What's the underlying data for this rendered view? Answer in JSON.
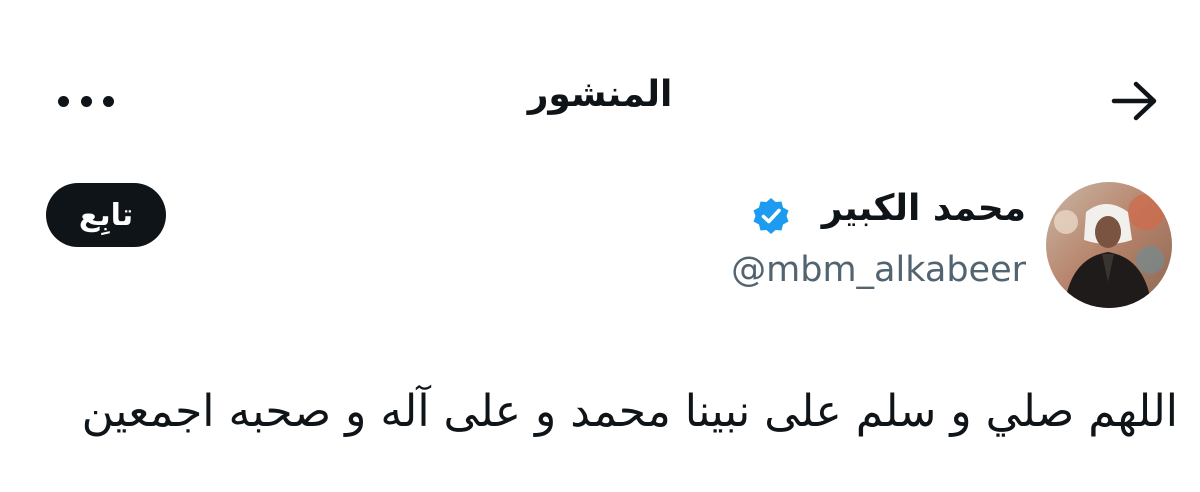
{
  "header": {
    "title": "المنشور",
    "back_icon": "arrow-right-icon",
    "more_icon": "more-horizontal-icon"
  },
  "author": {
    "name": "محمد الكبير",
    "handle": "@mbm_alkabeer",
    "verified": true,
    "verified_color": "#1d9bf0",
    "follow_label": "تابِع"
  },
  "post": {
    "text": "اللهم صلي و سلم على نبينا محمد و على آله و صحبه اجمعين"
  }
}
